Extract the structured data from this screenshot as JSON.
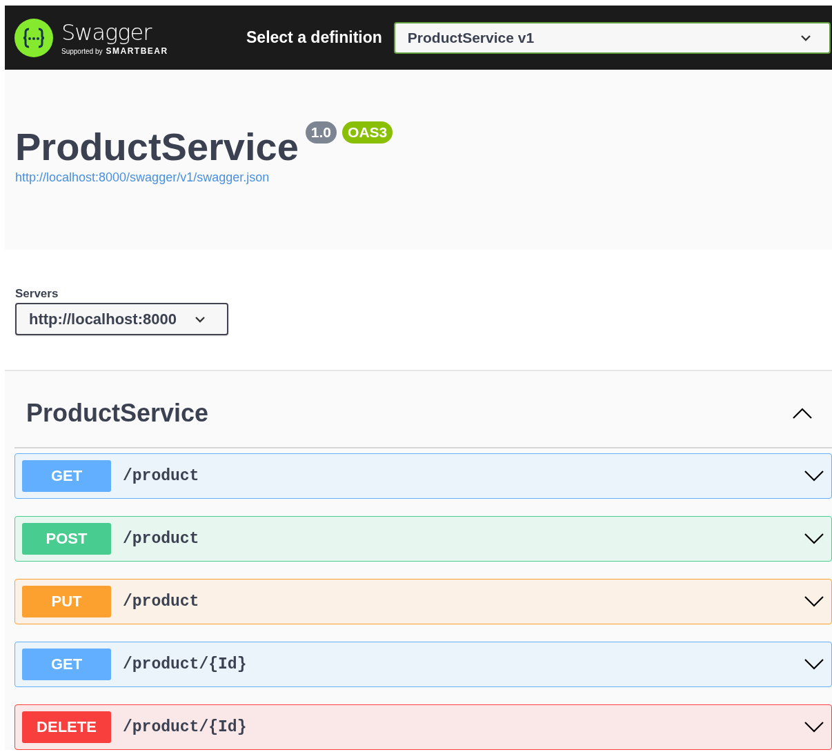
{
  "topbar": {
    "logo_text": "Swagger",
    "logo_sub_prefix": "Supported by",
    "logo_sub_brand": "SMARTBEAR",
    "definition_label": "Select a definition",
    "definition_value": "ProductService v1"
  },
  "info": {
    "title": "ProductService",
    "version": "1.0",
    "spec": "OAS3",
    "url": "http://localhost:8000/swagger/v1/swagger.json"
  },
  "servers": {
    "label": "Servers",
    "value": "http://localhost:8000"
  },
  "tag": {
    "name": "ProductService",
    "expanded": true
  },
  "operations": [
    {
      "method": "GET",
      "kind": "get",
      "path": "/product",
      "expanded": false
    },
    {
      "method": "POST",
      "kind": "post",
      "path": "/product",
      "expanded": false
    },
    {
      "method": "PUT",
      "kind": "put",
      "path": "/product",
      "expanded": false
    },
    {
      "method": "GET",
      "kind": "get",
      "path": "/product/{Id}",
      "expanded": false
    },
    {
      "method": "DELETE",
      "kind": "delete",
      "path": "/product/{Id}",
      "expanded": false
    }
  ]
}
